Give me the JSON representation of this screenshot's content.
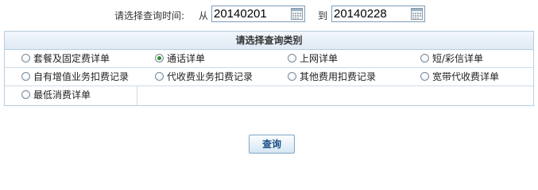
{
  "date_range": {
    "prompt": "请选择查询时间:",
    "from_label": "从",
    "from_value": "20140201",
    "to_label": "到",
    "to_value": "20140228"
  },
  "category": {
    "header": "请选择查询类别",
    "options": [
      {
        "label": "套餐及固定费详单",
        "checked": false
      },
      {
        "label": "通话详单",
        "checked": true
      },
      {
        "label": "上网详单",
        "checked": false
      },
      {
        "label": "短/彩信详单",
        "checked": false
      },
      {
        "label": "自有增值业务扣费记录",
        "checked": false
      },
      {
        "label": "代收费业务扣费记录",
        "checked": false
      },
      {
        "label": "其他费用扣费记录",
        "checked": false
      },
      {
        "label": "宽带代收费详单",
        "checked": false
      },
      {
        "label": "最低消费详单",
        "checked": false
      }
    ]
  },
  "query_button": {
    "label": "查询"
  },
  "icons": {
    "calendar": "calendar-icon"
  },
  "colors": {
    "panel_border": "#b7cde0",
    "header_bg": "#dfeaf5",
    "radio_checked": "#2a8f2a",
    "button_text": "#1c4f86"
  }
}
